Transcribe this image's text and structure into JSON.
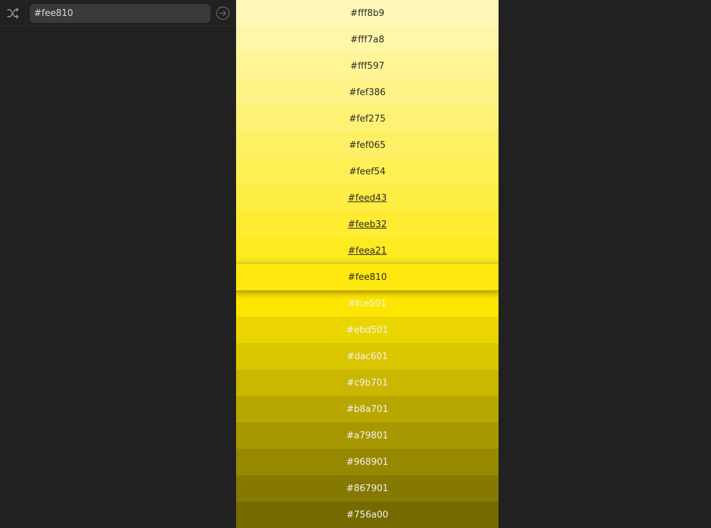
{
  "toolbar": {
    "shuffle_icon": "shuffle-icon",
    "search_value": "#fee810",
    "go_icon": "arrow-right-circle-icon"
  },
  "palette": {
    "selected": "#fee810",
    "swatches": [
      {
        "hex": "#fff8b9",
        "label": "#fff8b9"
      },
      {
        "hex": "#fff7a8",
        "label": "#fff7a8"
      },
      {
        "hex": "#fff597",
        "label": "#fff597"
      },
      {
        "hex": "#fef386",
        "label": "#fef386"
      },
      {
        "hex": "#fef275",
        "label": "#fef275"
      },
      {
        "hex": "#fef065",
        "label": "#fef065"
      },
      {
        "hex": "#feef54",
        "label": "#feef54"
      },
      {
        "hex": "#feed43",
        "label": "#feed43"
      },
      {
        "hex": "#feeb32",
        "label": "#feeb32"
      },
      {
        "hex": "#feea21",
        "label": "#feea21"
      },
      {
        "hex": "#fee810",
        "label": "#fee810"
      },
      {
        "hex": "#fce501",
        "label": "#fce501"
      },
      {
        "hex": "#ebd501",
        "label": "#ebd501"
      },
      {
        "hex": "#dac601",
        "label": "#dac601"
      },
      {
        "hex": "#c9b701",
        "label": "#c9b701"
      },
      {
        "hex": "#b8a701",
        "label": "#b8a701"
      },
      {
        "hex": "#a79801",
        "label": "#a79801"
      },
      {
        "hex": "#968901",
        "label": "#968901"
      },
      {
        "hex": "#867901",
        "label": "#867901"
      },
      {
        "hex": "#756a00",
        "label": "#756a00"
      }
    ]
  }
}
